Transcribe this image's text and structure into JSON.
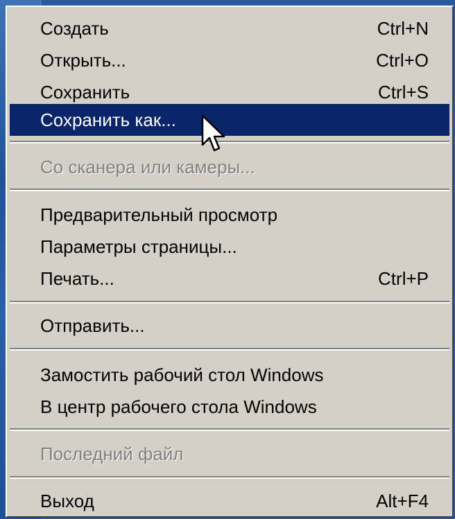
{
  "menu": {
    "items": [
      {
        "label": "Создать",
        "shortcut": "Ctrl+N"
      },
      {
        "label": "Открыть...",
        "shortcut": "Ctrl+O"
      },
      {
        "label": "Сохранить",
        "shortcut": "Ctrl+S"
      },
      {
        "label": "Сохранить как...",
        "shortcut": ""
      },
      {
        "label": "Со сканера или камеры...",
        "shortcut": ""
      },
      {
        "label": "Предварительный просмотр",
        "shortcut": ""
      },
      {
        "label": "Параметры страницы...",
        "shortcut": ""
      },
      {
        "label": "Печать...",
        "shortcut": "Ctrl+P"
      },
      {
        "label": "Отправить...",
        "shortcut": ""
      },
      {
        "label": "Замостить рабочий стол Windows",
        "shortcut": ""
      },
      {
        "label": "В центр рабочего стола Windows",
        "shortcut": ""
      },
      {
        "label": "Последний файл",
        "shortcut": ""
      },
      {
        "label": "Выход",
        "shortcut": "Alt+F4"
      }
    ],
    "highlighted_item": "Сохранить как...",
    "disabled_items": [
      "Со сканера или камеры...",
      "Последний файл"
    ]
  },
  "cursor": {
    "icon": "arrow-pointer-icon"
  },
  "colors": {
    "menu_background": "#d4d0c8",
    "highlight": "#0a246a",
    "highlight_text": "#ffffff",
    "disabled_text": "#808080",
    "desktop": "#2a5a9c"
  }
}
